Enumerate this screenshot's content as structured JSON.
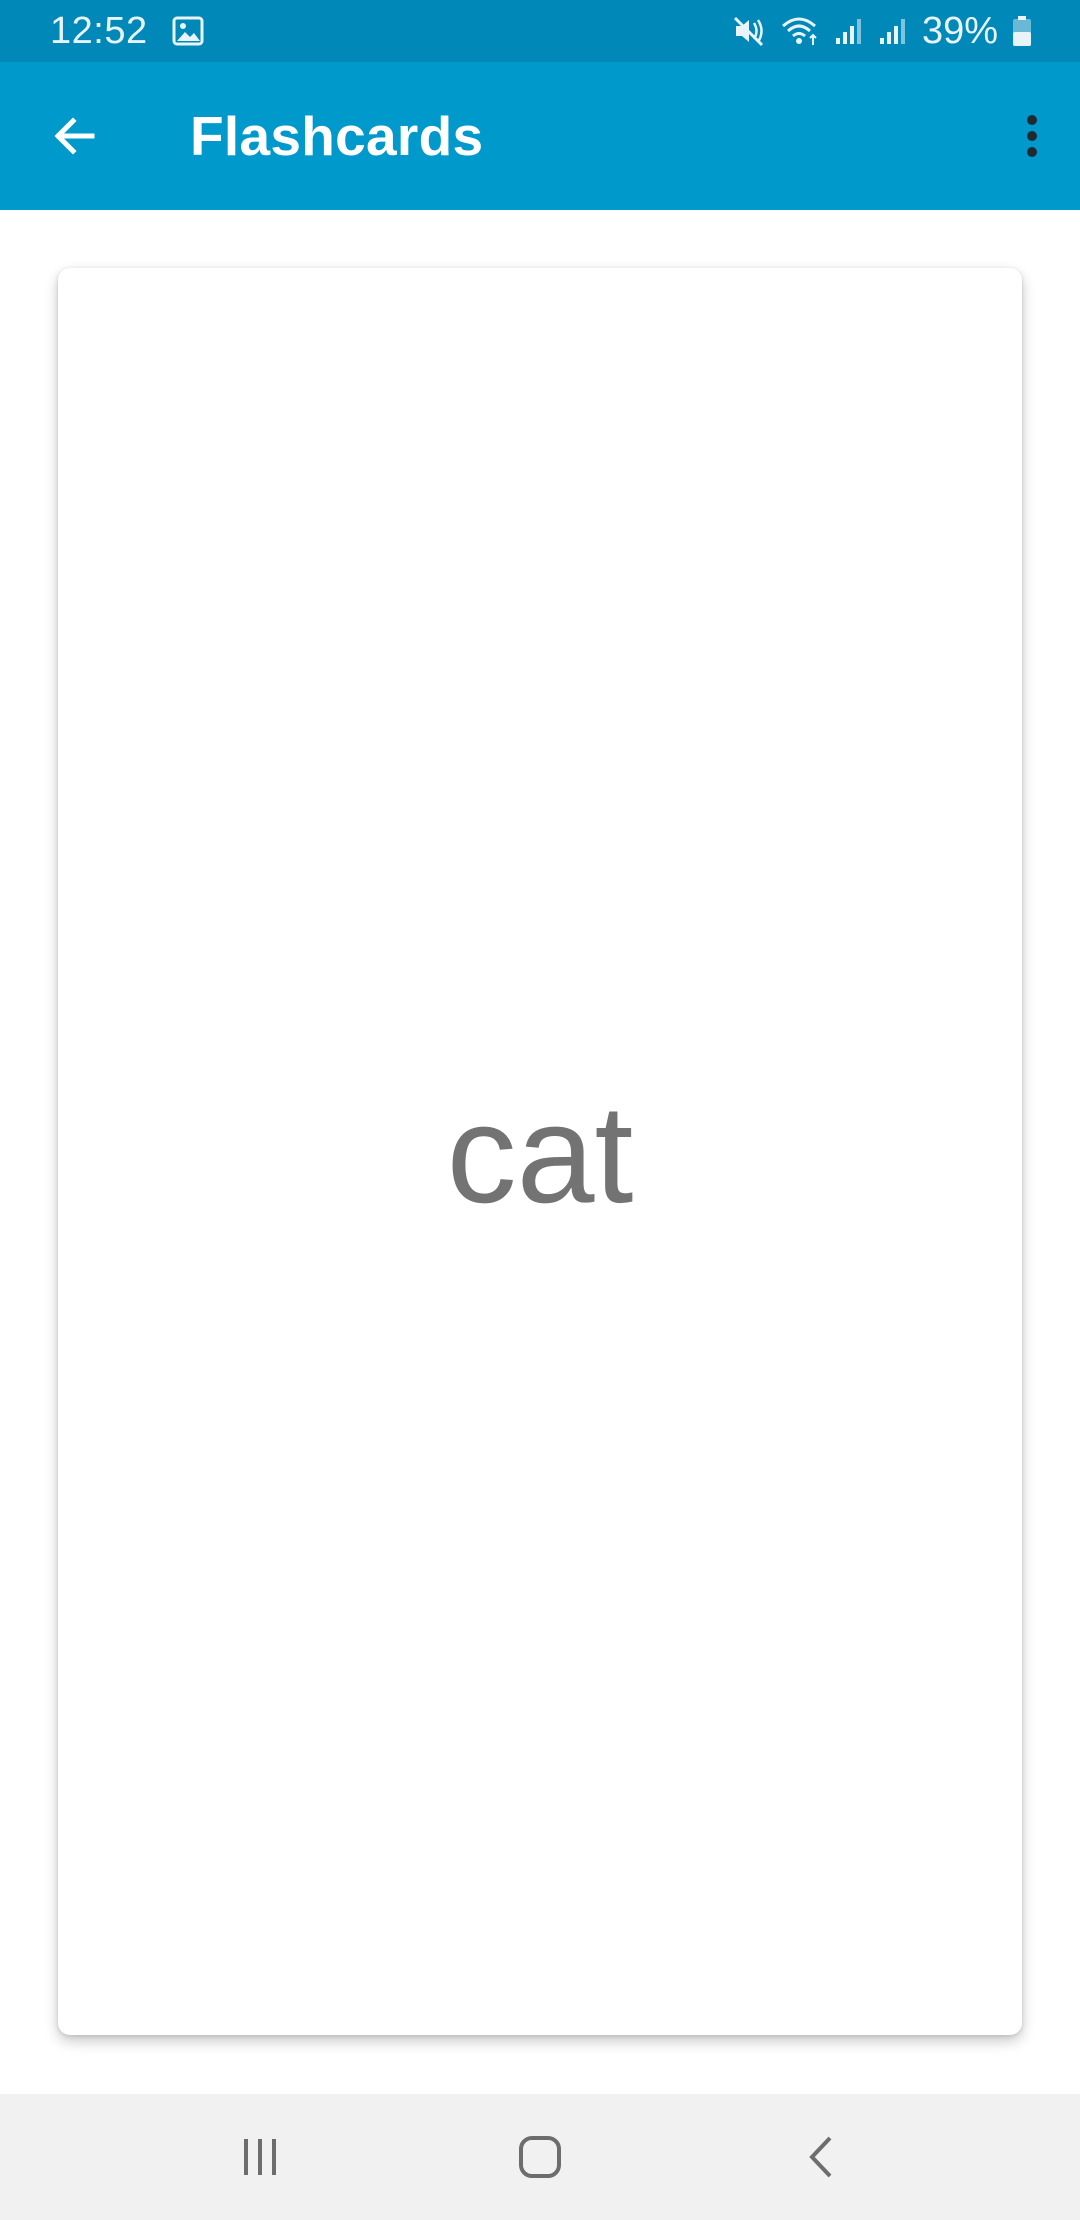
{
  "status_bar": {
    "time": "12:52",
    "battery_percent": "39%",
    "icons": [
      "gallery-notification-icon",
      "mute-icon",
      "wifi-icon",
      "signal-icon",
      "signal-icon",
      "battery-icon"
    ],
    "background_color": "#0088b8"
  },
  "app_bar": {
    "title": "Flashcards",
    "back_icon": "arrow-back-icon",
    "menu_icon": "more-vert-icon",
    "background_color": "#0099cc"
  },
  "flashcard": {
    "word": "cat",
    "text_color": "#737373"
  },
  "nav_bar": {
    "buttons": [
      "recents-icon",
      "home-icon",
      "back-icon"
    ],
    "background_color": "#f1f1f1"
  }
}
